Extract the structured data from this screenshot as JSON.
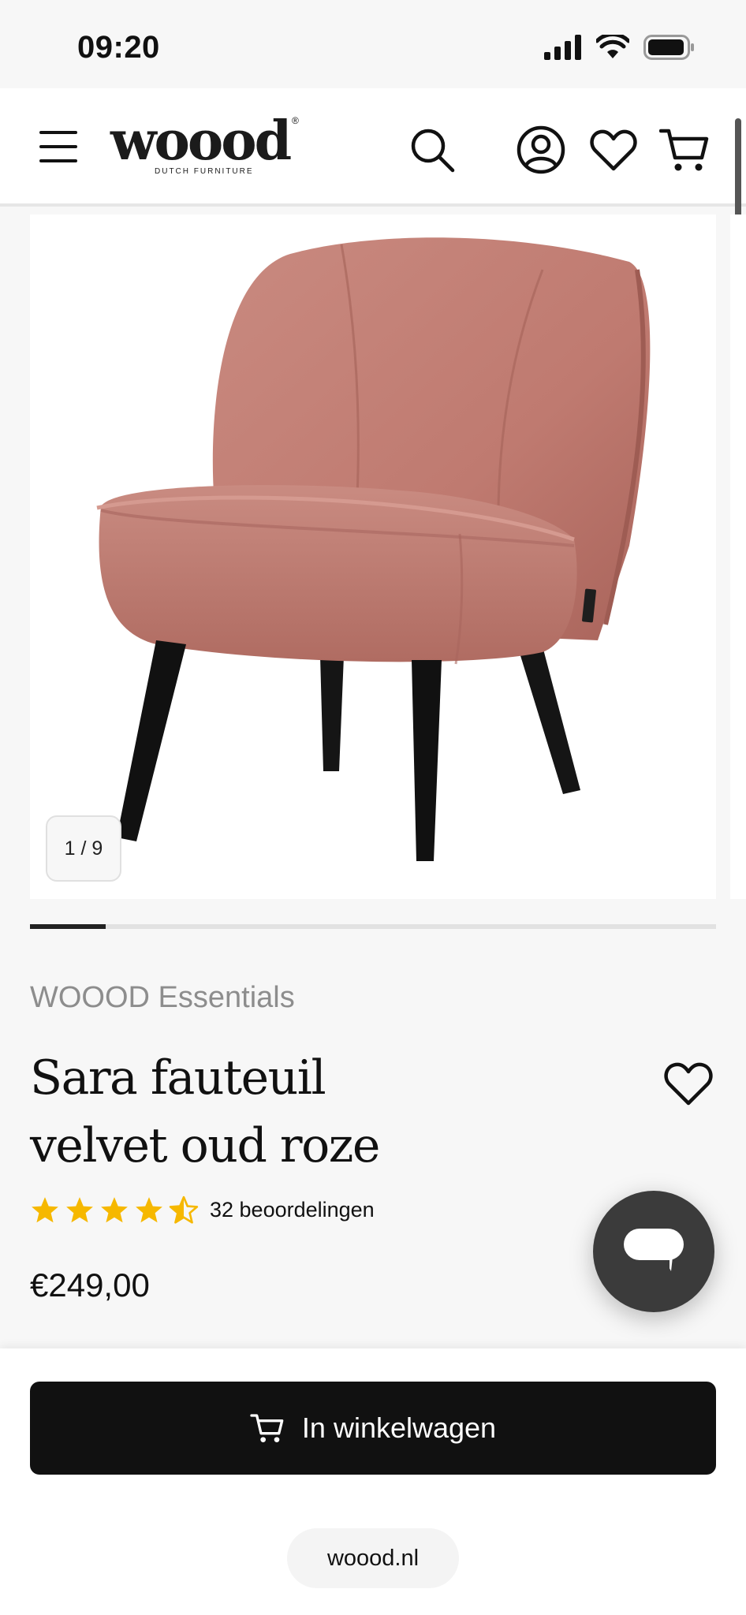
{
  "status_bar": {
    "time": "09:20"
  },
  "header": {
    "logo_text": "woood",
    "logo_tagline": "DUTCH FURNITURE",
    "logo_mark": "®"
  },
  "gallery": {
    "counter": "1 / 9",
    "progress_fraction": 0.11
  },
  "product": {
    "brand": "WOOOD Essentials",
    "title": "Sara fauteuil velvet oud roze",
    "rating_value": 4.5,
    "rating_max": 5,
    "rating_count": "32 beoordelingen",
    "price": "€249,00"
  },
  "cta": {
    "add_to_cart_label": "In winkelwagen"
  },
  "browser": {
    "url": "woood.nl"
  },
  "colors": {
    "star": "#f6b800",
    "cta_bg": "#111111",
    "chat_bg": "#3b3b3b",
    "chair_velvet": "#c47d73"
  },
  "icons": [
    "menu-icon",
    "search-icon",
    "account-icon",
    "heart-icon",
    "cart-icon",
    "chat-icon",
    "star-icon"
  ]
}
